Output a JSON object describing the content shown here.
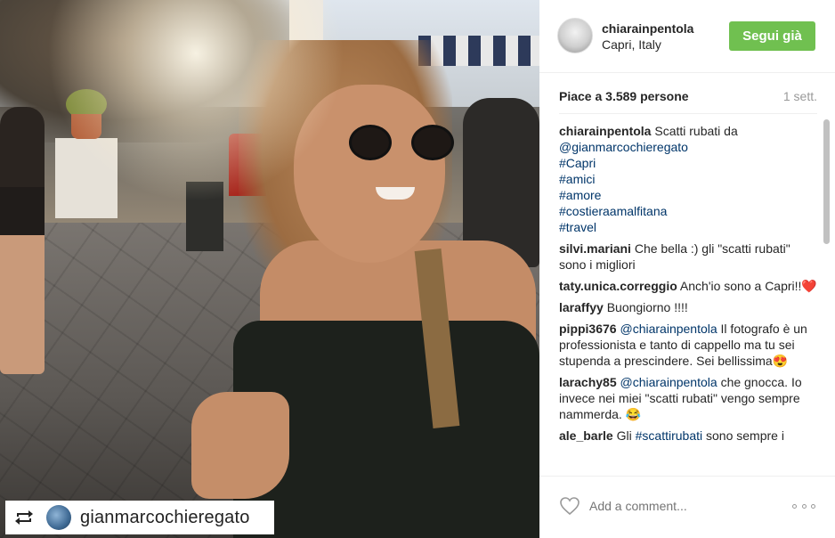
{
  "post": {
    "repost_username": "gianmarcochieregato",
    "repost_icon": "repost-icon"
  },
  "header": {
    "username": "chiarainpentola",
    "location": "Capri, Italy",
    "follow_label": "Segui già"
  },
  "stats": {
    "likes": "Piace a 3.589 persone",
    "time": "1 sett."
  },
  "caption": {
    "username": "chiarainpentola",
    "text": "Scatti rubati da",
    "mention": "@gianmarcochieregato",
    "tags": [
      "#Capri",
      "#amici",
      "#amore",
      "#costieraamalfitana",
      "#travel"
    ]
  },
  "comments": [
    {
      "user": "silvi.mariani",
      "text": "Che bella :) gli \"scatti rubati\" sono i migliori"
    },
    {
      "user": "taty.unica.correggio",
      "text": "Anch'io sono a Capri!!❤️"
    },
    {
      "user": "laraffyy",
      "text": "Buongiorno !!!!"
    },
    {
      "user": "pippi3676",
      "mention": "@chiarainpentola",
      "text": "Il fotografo è un professionista e tanto di cappello ma tu sei stupenda a prescindere. Sei bellissima😍"
    },
    {
      "user": "larachy85",
      "mention": "@chiarainpentola",
      "text": "che gnocca. Io invece nei miei \"scatti rubati\" vengo sempre nammerda. 😂"
    },
    {
      "user": "ale_barle",
      "text": "Gli",
      "mention": "#scattirubati",
      "text2": "sono sempre i"
    }
  ],
  "footer": {
    "comment_placeholder": "Add a comment...",
    "heart_icon": "heart-outline-icon",
    "more_icon": "more-options-icon"
  },
  "colors": {
    "follow_button": "#70c050",
    "link": "#003569",
    "muted": "#999999"
  }
}
